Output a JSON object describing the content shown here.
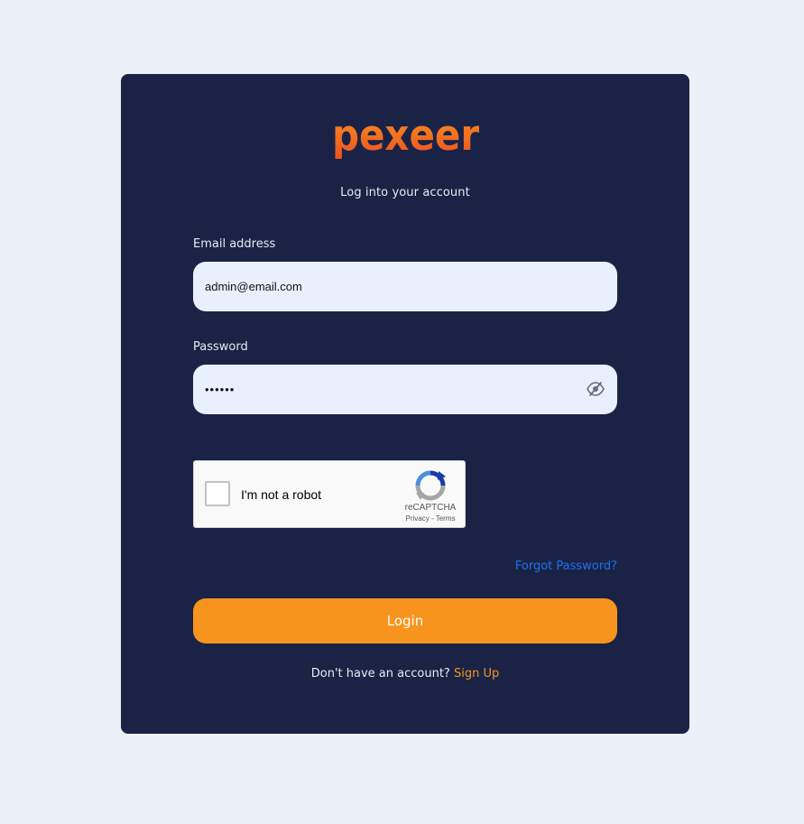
{
  "brand": {
    "name": "pexeer",
    "logo_icon": "pexeer-logo",
    "colors": {
      "top": "#f7941d",
      "bottom": "#ec4d24"
    }
  },
  "subtitle": "Log into your account",
  "email": {
    "label": "Email address",
    "value": "admin@email.com"
  },
  "password": {
    "label": "Password",
    "value": "••••••",
    "toggle_icon": "eye-slash-icon"
  },
  "recaptcha": {
    "label": "I'm not a robot",
    "brand": "reCAPTCHA",
    "privacy": "Privacy",
    "separator": " - ",
    "terms": "Terms",
    "icon": "recaptcha-icon"
  },
  "forgot_password": "Forgot Password?",
  "login_button": "Login",
  "signup": {
    "prompt": "Don't have an account?",
    "link": "Sign Up"
  },
  "colors": {
    "page_bg": "#ecf0f8",
    "card_bg": "#1a2346",
    "accent": "#f7941d",
    "link": "#1e6ff0",
    "input_bg": "#e8f0fe"
  }
}
